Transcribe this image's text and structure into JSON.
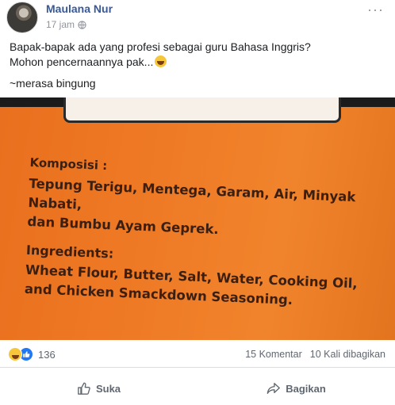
{
  "post": {
    "author": "Maulana Nur",
    "time": "17 jam",
    "text_line1": "Bapak-bapak ada yang profesi sebagai guru Bahasa Inggris?",
    "text_line2": "Mohon pencernaannya pak...",
    "text_line3": "~merasa bingung"
  },
  "photo": {
    "komposisi_heading": "Komposisi :",
    "komposisi_line1": "Tepung Terigu, Mentega, Garam, Air, Minyak Nabati,",
    "komposisi_line2": "dan Bumbu Ayam Geprek.",
    "ingredients_heading": "Ingredients:",
    "ingredients_line1": "Wheat Flour, Butter, Salt, Water, Cooking Oil,",
    "ingredients_line2": "and Chicken Smackdown Seasoning."
  },
  "stats": {
    "reaction_count": "136",
    "comments": "15 Komentar",
    "shares": "10 Kali dibagikan"
  },
  "actions": {
    "like": "Suka",
    "share": "Bagikan"
  },
  "icons": [
    "avatar",
    "globe-icon",
    "more-icon",
    "haha-reaction-icon",
    "like-reaction-icon",
    "thumbs-up-icon",
    "share-icon"
  ],
  "colors": {
    "author": "#385898",
    "photo_orange": "#ef7a25",
    "like_blue": "#2078f4"
  }
}
